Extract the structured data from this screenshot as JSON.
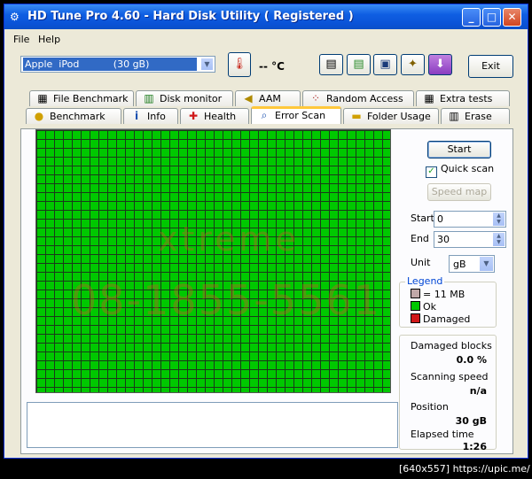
{
  "window": {
    "title": "HD Tune Pro 4.60 - Hard Disk Utility (  Registered )",
    "minimize": "_",
    "maximize": "□",
    "close": "✕"
  },
  "menu": {
    "file": "File",
    "help": "Help"
  },
  "toolbar": {
    "drive": "Apple  iPod           (30 gB)",
    "temperature": "-- °C",
    "exit_label": "Exit"
  },
  "tabs_top": [
    {
      "label": "File Benchmark",
      "icon": "file-benchmark-icon"
    },
    {
      "label": "Disk monitor",
      "icon": "disk-monitor-icon"
    },
    {
      "label": "AAM",
      "icon": "speaker-icon"
    },
    {
      "label": "Random Access",
      "icon": "random-access-icon"
    },
    {
      "label": "Extra tests",
      "icon": "extra-tests-icon"
    }
  ],
  "tabs_bottom": [
    {
      "label": "Benchmark",
      "icon": "benchmark-icon"
    },
    {
      "label": "Info",
      "icon": "info-icon"
    },
    {
      "label": "Health",
      "icon": "health-icon"
    },
    {
      "label": "Error Scan",
      "icon": "magnifier-icon"
    },
    {
      "label": "Folder Usage",
      "icon": "folder-icon"
    },
    {
      "label": "Erase",
      "icon": "trash-icon"
    }
  ],
  "scan": {
    "start_button": "Start",
    "quick_scan": "Quick scan",
    "quick_scan_checked": true,
    "speed_map_button": "Speed map",
    "start_label": "Start",
    "start_value": "0",
    "end_label": "End",
    "end_value": "30",
    "unit_label": "Unit",
    "unit_value": "gB"
  },
  "legend": {
    "title": "Legend",
    "items": [
      {
        "label": "= 11 MB",
        "color": "#c0a8a8"
      },
      {
        "label": "Ok",
        "color": "#00c800"
      },
      {
        "label": "Damaged",
        "color": "#d01818"
      }
    ]
  },
  "stats": {
    "damaged_blocks_label": "Damaged blocks",
    "damaged_blocks_value": "0.0 %",
    "scanning_speed_label": "Scanning speed",
    "scanning_speed_value": "n/a",
    "position_label": "Position",
    "position_value": "30 gB",
    "elapsed_label": "Elapsed time",
    "elapsed_value": "1:26"
  },
  "watermark": {
    "line1": "xtreme",
    "line2": "08-1855-5561"
  },
  "footer": "[640x557] https://upic.me/",
  "colors": {
    "grid_ok": "#00c800",
    "title_bar": "#0a52d6",
    "active_tab_accent": "#ffc83c"
  }
}
